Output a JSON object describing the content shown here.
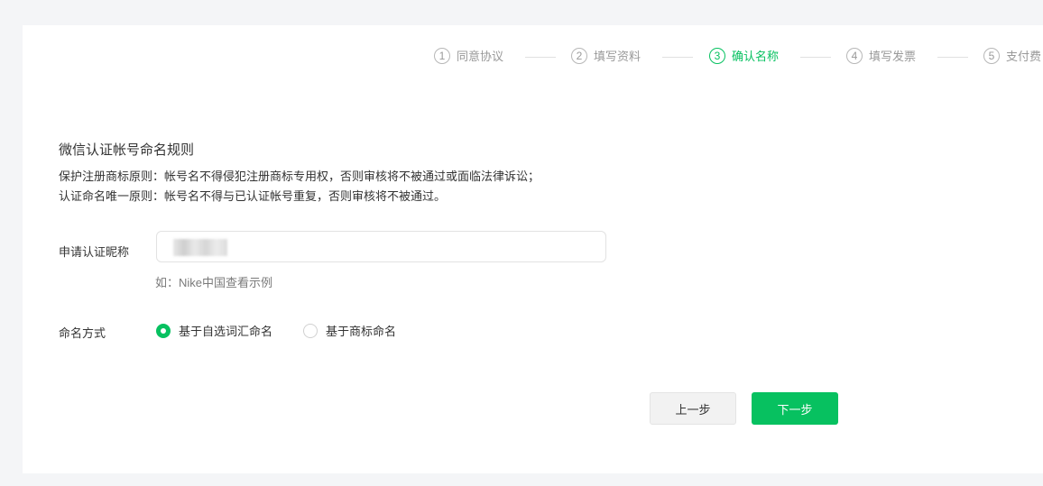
{
  "steps": [
    {
      "num": "1",
      "label": "同意协议"
    },
    {
      "num": "2",
      "label": "填写资料"
    },
    {
      "num": "3",
      "label": "确认名称"
    },
    {
      "num": "4",
      "label": "填写发票"
    },
    {
      "num": "5",
      "label": "支付费"
    }
  ],
  "active_step": 3,
  "rules": {
    "title": "微信认证帐号命名规则",
    "line1": "保护注册商标原则：帐号名不得侵犯注册商标专用权，否则审核将不被通过或面临法律诉讼；",
    "line2": "认证命名唯一原则：帐号名不得与已认证帐号重复，否则审核将不被通过。"
  },
  "form": {
    "name_label": "申请认证昵称",
    "name_hint": "如：Nike中国查看示例",
    "method_label": "命名方式",
    "options": [
      "基于自选词汇命名",
      "基于商标命名"
    ],
    "selected_option": "基于自选词汇命名"
  },
  "buttons": {
    "prev": "上一步",
    "next": "下一步"
  },
  "colors": {
    "accent": "#07c160",
    "page_bg": "#f4f5f7"
  }
}
